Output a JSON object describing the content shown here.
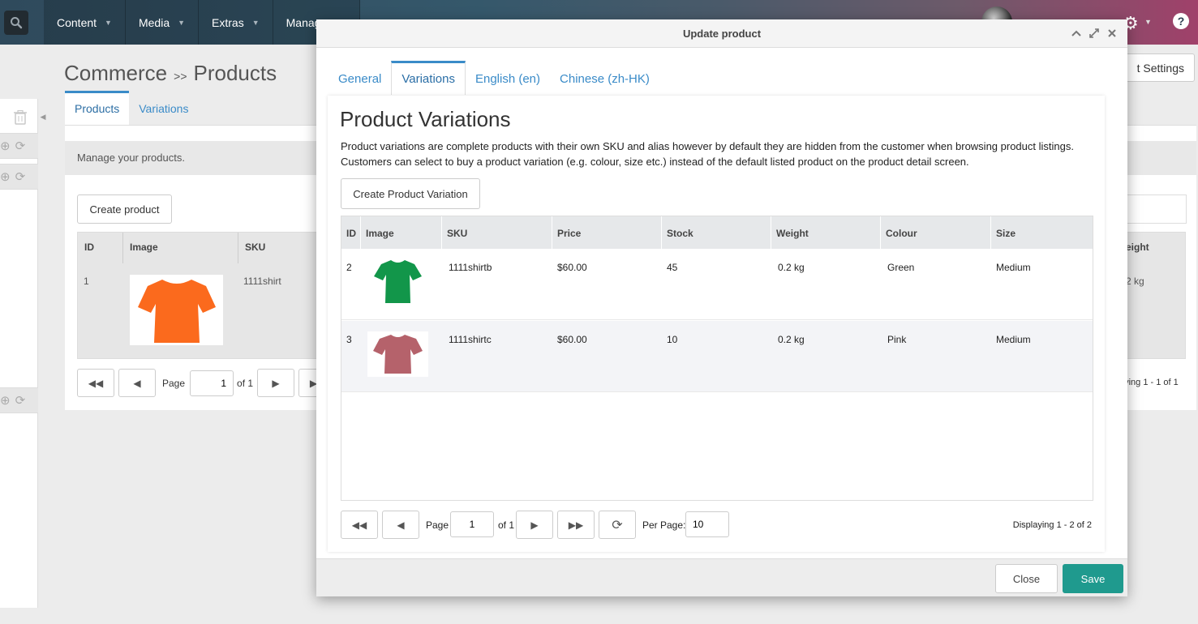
{
  "topnav": {
    "items": [
      {
        "label": "Content"
      },
      {
        "label": "Media"
      },
      {
        "label": "Extras"
      },
      {
        "label": "Manage"
      }
    ]
  },
  "page": {
    "title_part1": "Commerce",
    "title_sep": ">>",
    "title_part2": "Products",
    "tabs": [
      "Products",
      "Variations"
    ],
    "description": "Manage your products.",
    "create_label": "Create product",
    "settings_label": "t Settings",
    "grid_headers": [
      "ID",
      "Image",
      "SKU"
    ],
    "row": {
      "id": "1",
      "sku": "1111shirt"
    },
    "right_header": "eight",
    "right_cell": "2 kg",
    "pager": {
      "page_label": "Page",
      "page_value": "1",
      "of_label": "of 1"
    },
    "display_text": "aying 1 - 1 of 1"
  },
  "modal": {
    "title": "Update product",
    "tabs": [
      "General",
      "Variations",
      "English (en)",
      "Chinese (zh-HK)"
    ],
    "active_tab": "Variations",
    "heading": "Product Variations",
    "description": "Product variations are complete products with their own SKU and alias however by default they are hidden from the customer when browsing product listings. Customers can select to buy a product variation (e.g. colour, size etc.) instead of the default listed product on the product detail screen.",
    "create_label": "Create Product Variation",
    "columns": [
      "ID",
      "Image",
      "SKU",
      "Price",
      "Stock",
      "Weight",
      "Colour",
      "Size"
    ],
    "rows": [
      {
        "id": "2",
        "image": "green-shirt",
        "sku": "1111shirtb",
        "price": "$60.00",
        "stock": "45",
        "weight": "0.2 kg",
        "colour": "Green",
        "size": "Medium"
      },
      {
        "id": "3",
        "image": "pink-shirt",
        "sku": "1111shirtc",
        "price": "$60.00",
        "stock": "10",
        "weight": "0.2 kg",
        "colour": "Pink",
        "size": "Medium"
      }
    ],
    "pager": {
      "page_label": "Page",
      "page_value": "1",
      "of_label": "of 1",
      "per_page_label": "Per Page:",
      "per_page_value": "10",
      "display_text": "Displaying 1 - 2 of 2"
    },
    "close_label": "Close",
    "save_label": "Save"
  },
  "colors": {
    "accent": "#3a8bc8",
    "save": "#1f9a8e",
    "shirt_green": "#12964a",
    "shirt_pink": "#b5626b",
    "shirt_orange": "#fb6a1d"
  }
}
